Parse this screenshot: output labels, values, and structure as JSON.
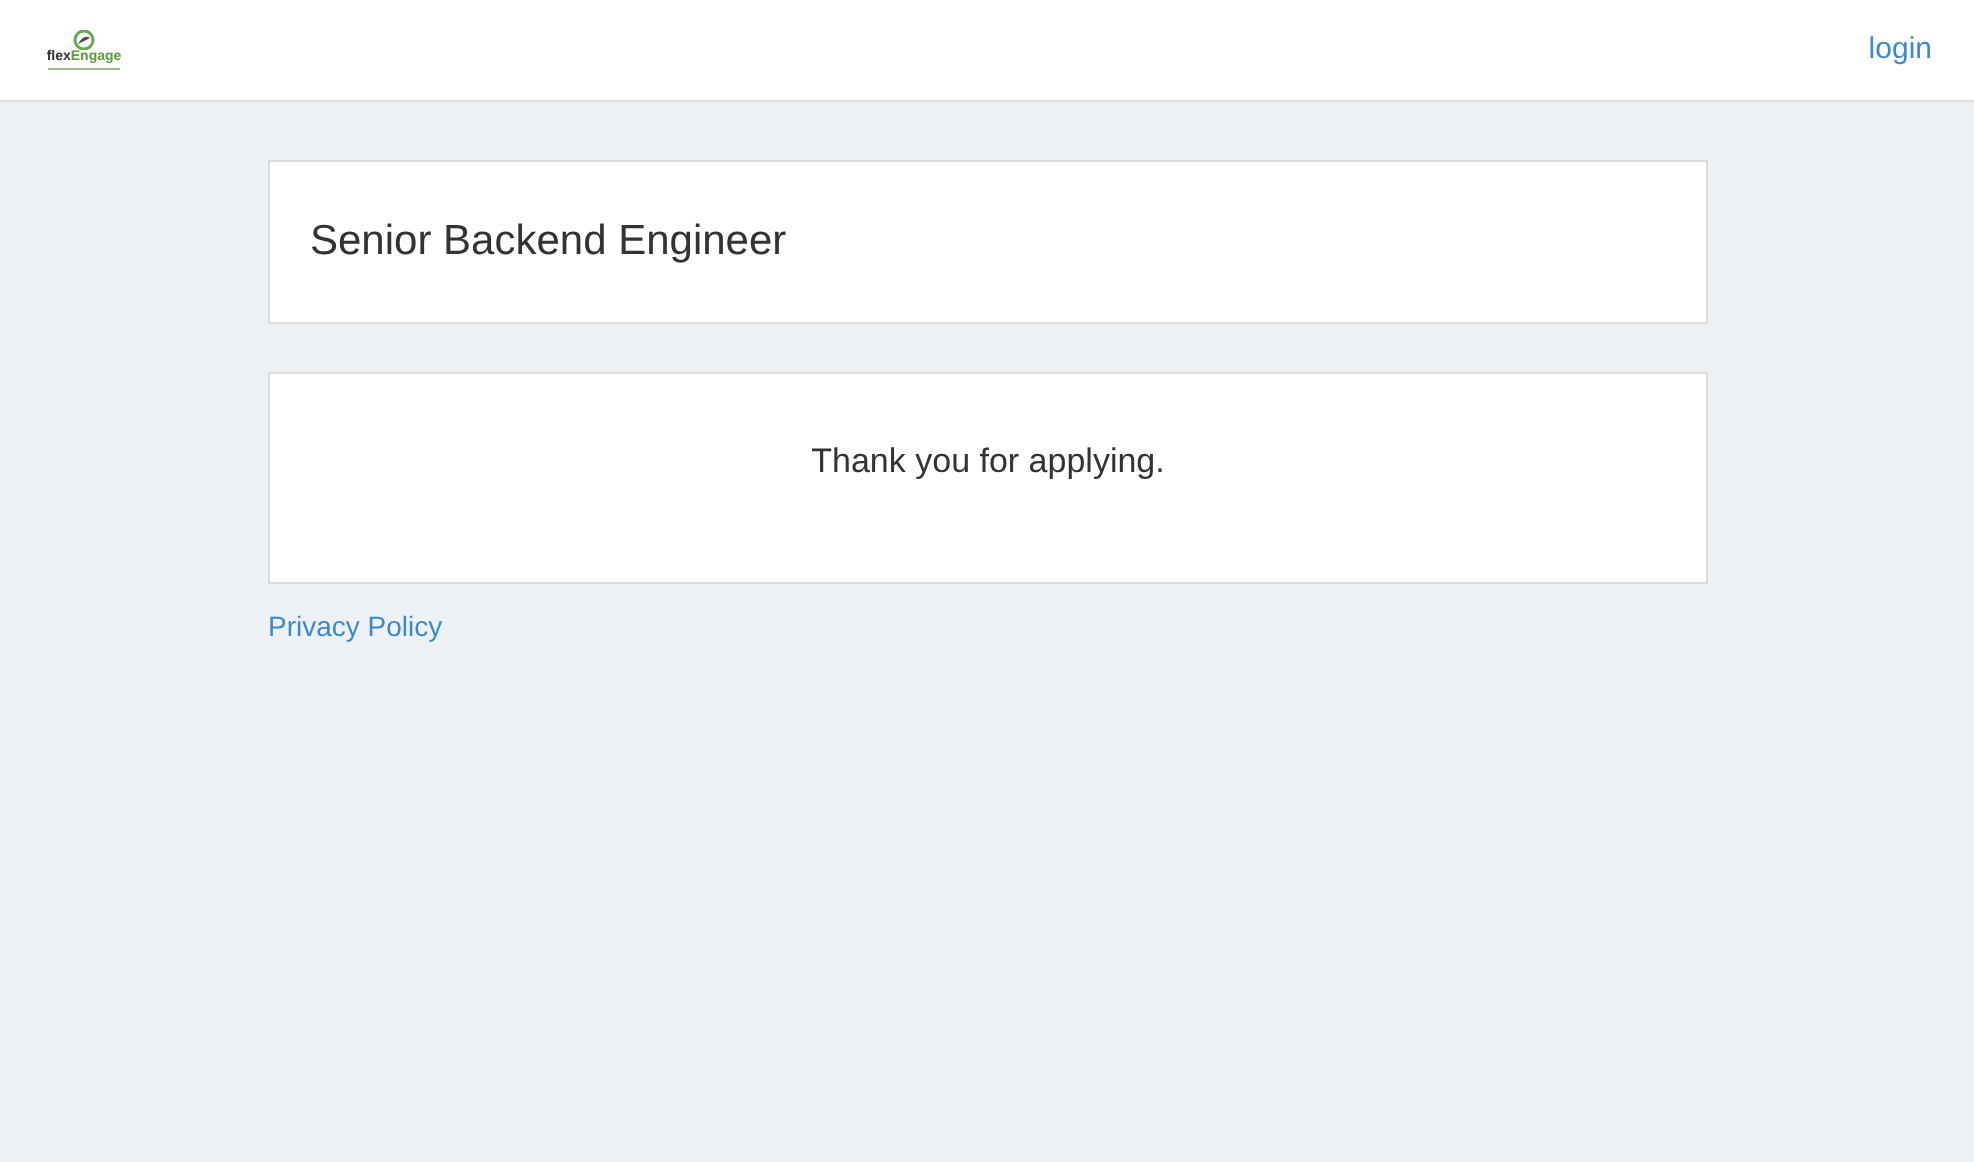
{
  "header": {
    "logo": {
      "part_1": "flex",
      "part_2": "Engage"
    },
    "login_link": "login"
  },
  "job_card": {
    "title": "Senior Backend Engineer"
  },
  "message_card": {
    "text": "Thank you for applying."
  },
  "footer": {
    "privacy_link": "Privacy Policy"
  }
}
